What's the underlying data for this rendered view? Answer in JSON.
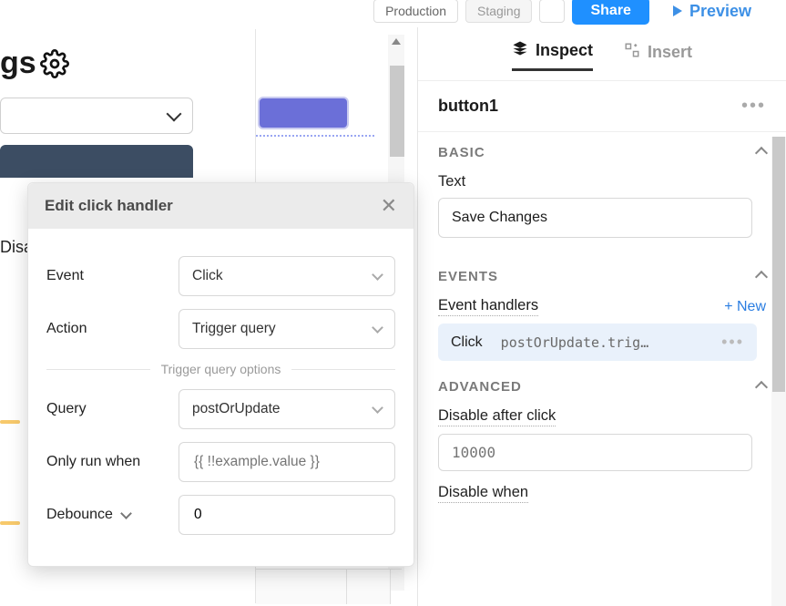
{
  "topbar": {
    "env_production": "Production",
    "env_staging": "Staging",
    "share_label": "Share",
    "preview_label": "Preview"
  },
  "left": {
    "gs_suffix": "gs",
    "disable_fragment": "Disa"
  },
  "modal": {
    "title": "Edit click handler",
    "event_label": "Event",
    "event_value": "Click",
    "action_label": "Action",
    "action_value": "Trigger query",
    "divider_text": "Trigger query options",
    "query_label": "Query",
    "query_value": "postOrUpdate",
    "only_run_label": "Only run when",
    "only_run_placeholder": "{{ !!example.value }}",
    "debounce_label": "Debounce",
    "debounce_value": "0"
  },
  "right": {
    "tab_inspect": "Inspect",
    "tab_insert": "Insert",
    "component_name": "button1",
    "basic_heading": "BASIC",
    "text_label": "Text",
    "text_value": "Save Changes",
    "events_heading": "EVENTS",
    "event_handlers_label": "Event handlers",
    "new_label": "+ New",
    "handler_event": "Click",
    "handler_code": "postOrUpdate.trig…",
    "advanced_heading": "ADVANCED",
    "disable_after_label": "Disable after click",
    "disable_after_placeholder": "10000",
    "disable_when_label": "Disable when"
  }
}
